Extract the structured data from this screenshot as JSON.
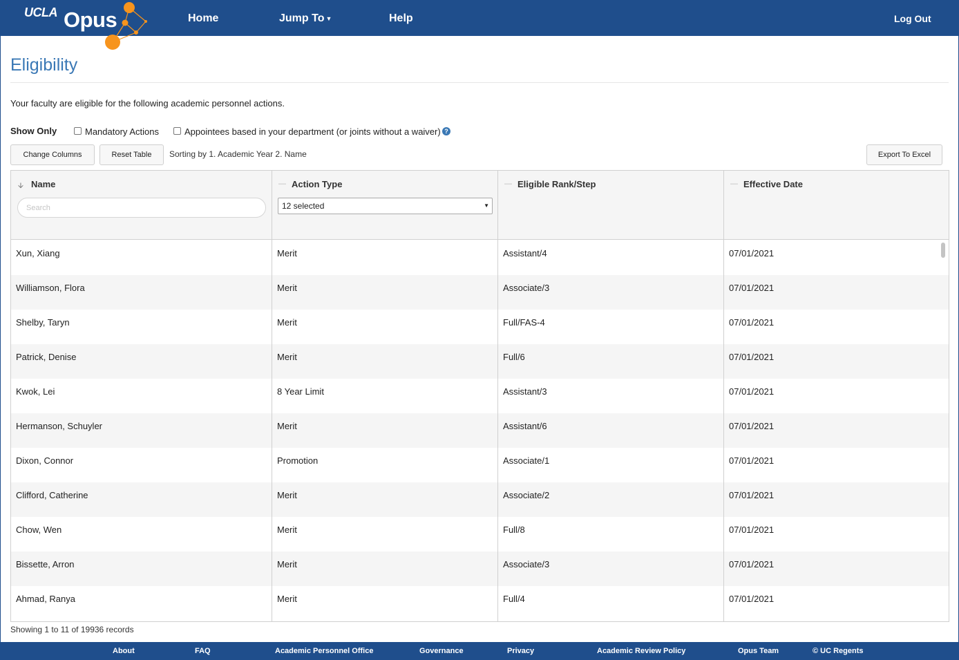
{
  "header": {
    "logo_ucla": "UCLA",
    "logo_opus": "Opus",
    "nav": {
      "home": "Home",
      "jump_to": "Jump To",
      "help": "Help",
      "logout": "Log Out"
    }
  },
  "page": {
    "title": "Eligibility",
    "intro": "Your faculty are eligible for the following academic personnel actions."
  },
  "filters": {
    "show_only": "Show Only",
    "mandatory_label": "Mandatory Actions",
    "appointees_label": "Appointees based in your department (or joints without a waiver)",
    "help_glyph": "?"
  },
  "toolbar": {
    "change_columns": "Change Columns",
    "reset_table": "Reset Table",
    "sorting": "Sorting by 1. Academic Year 2. Name",
    "export": "Export To Excel"
  },
  "table": {
    "columns": {
      "name": "Name",
      "action_type": "Action Type",
      "rank_step": "Eligible Rank/Step",
      "effective_date": "Effective Date"
    },
    "search_placeholder": "Search",
    "action_filter": "12 selected",
    "rows": [
      [
        "Xun, Xiang",
        "Merit",
        "Assistant/4",
        "07/01/2021"
      ],
      [
        "Williamson, Flora",
        "Merit",
        "Associate/3",
        "07/01/2021"
      ],
      [
        "Shelby, Taryn",
        "Merit",
        "Full/FAS-4",
        "07/01/2021"
      ],
      [
        "Patrick, Denise",
        "Merit",
        "Full/6",
        "07/01/2021"
      ],
      [
        "Kwok, Lei",
        "8 Year Limit",
        "Assistant/3",
        "07/01/2021"
      ],
      [
        "Hermanson, Schuyler",
        "Merit",
        "Assistant/6",
        "07/01/2021"
      ],
      [
        "Dixon, Connor",
        "Promotion",
        "Associate/1",
        "07/01/2021"
      ],
      [
        "Clifford, Catherine",
        "Merit",
        "Associate/2",
        "07/01/2021"
      ],
      [
        "Chow, Wen",
        "Merit",
        "Full/8",
        "07/01/2021"
      ],
      [
        "Bissette, Arron",
        "Merit",
        "Associate/3",
        "07/01/2021"
      ],
      [
        "Ahmad, Ranya",
        "Merit",
        "Full/4",
        "07/01/2021"
      ]
    ],
    "records": "Showing 1 to 11 of 19936 records"
  },
  "footer": {
    "links": [
      "About",
      "FAQ",
      "Academic Personnel Office",
      "Governance",
      "Privacy",
      "Academic Review Policy",
      "Opus Team",
      "© UC Regents"
    ]
  },
  "colors": {
    "brand_blue": "#1f4e8c",
    "title_blue": "#3a78b5",
    "accent_orange": "#f7941d"
  },
  "icons": {
    "sort_desc": "sort-desc-icon",
    "sort_none": "sort-none-icon",
    "help": "help-icon",
    "caret": "caret-down-icon"
  }
}
